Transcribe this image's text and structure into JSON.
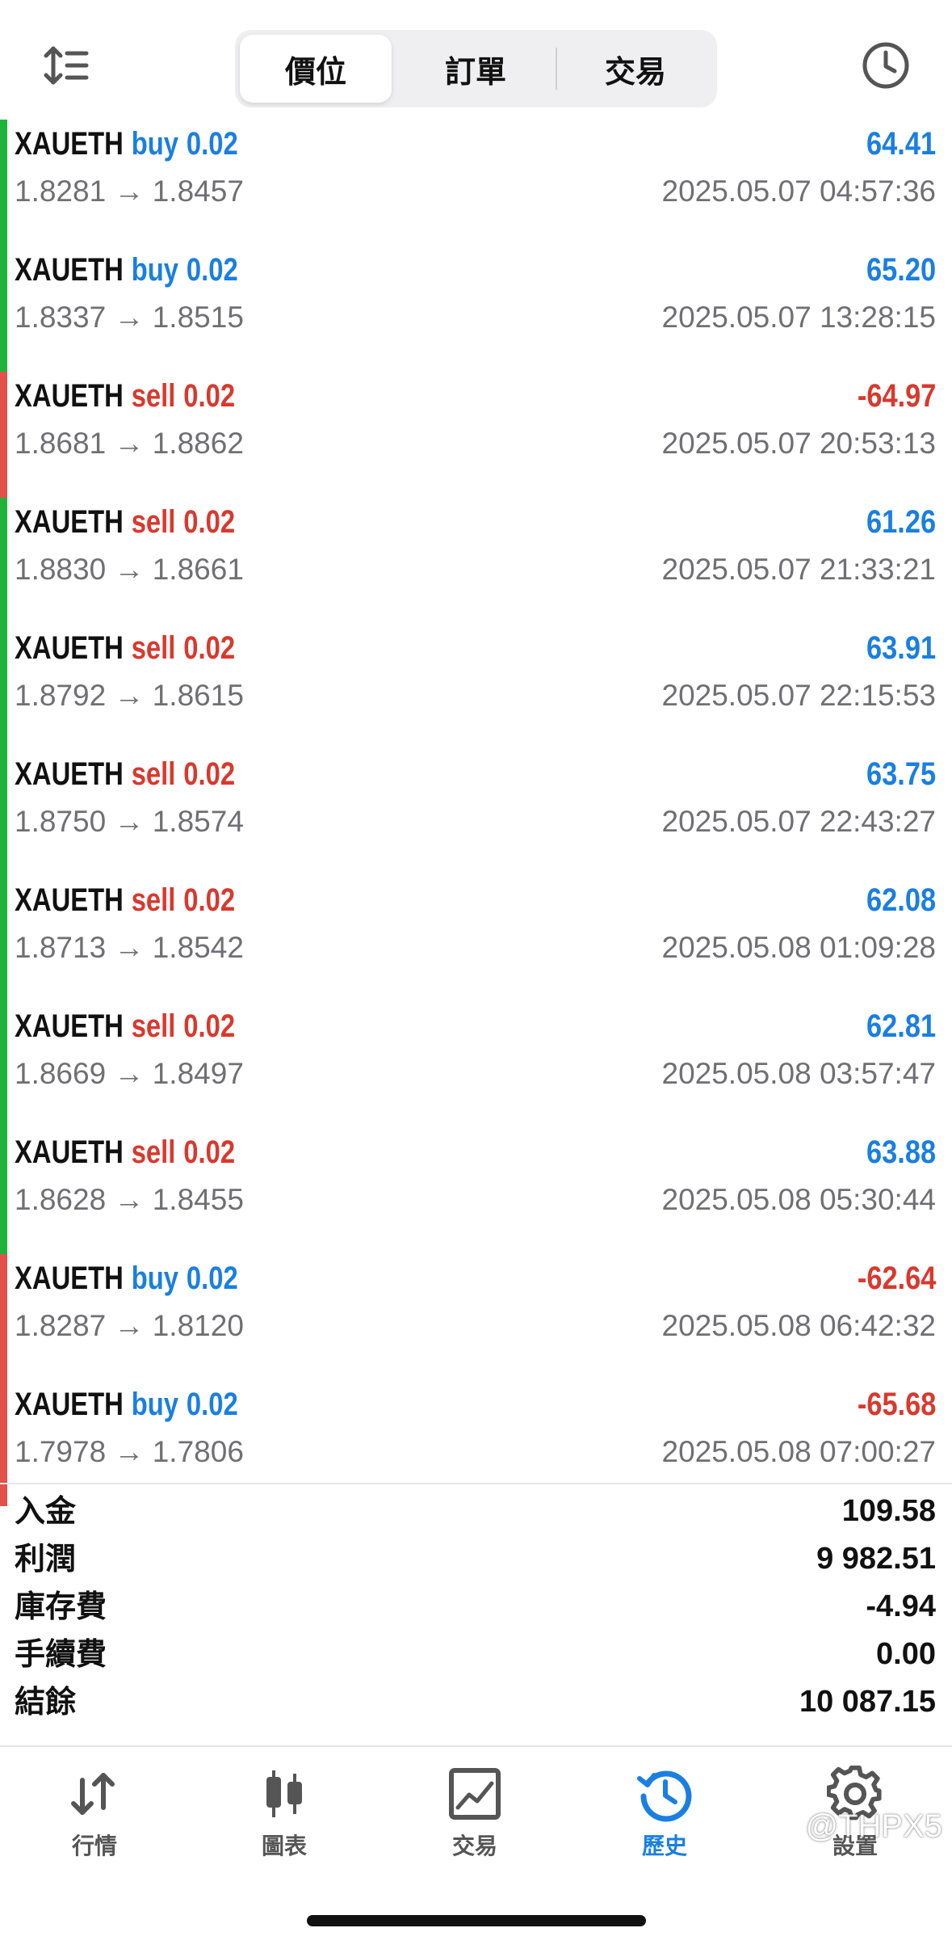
{
  "header": {
    "tabs": [
      {
        "label": "價位",
        "active": true
      },
      {
        "label": "訂單",
        "active": false
      },
      {
        "label": "交易",
        "active": false
      }
    ],
    "icons": {
      "sort": "sort-updown-icon",
      "history_period": "clock-icon"
    }
  },
  "deals": [
    {
      "symbol": "XAUETH",
      "type": "buy",
      "volume": "0.02",
      "profit": "64.41",
      "open": "1.8281",
      "close": "1.8457",
      "time": "2025.05.07 04:57:36",
      "bar_color": "#1fb33a",
      "type_color": "#1a7fe0",
      "profit_color": "#1a7fe0"
    },
    {
      "symbol": "XAUETH",
      "type": "buy",
      "volume": "0.02",
      "profit": "65.20",
      "open": "1.8337",
      "close": "1.8515",
      "time": "2025.05.07 13:28:15",
      "bar_color": "#1fb33a",
      "type_color": "#1a7fe0",
      "profit_color": "#1a7fe0"
    },
    {
      "symbol": "XAUETH",
      "type": "sell",
      "volume": "0.02",
      "profit": "-64.97",
      "open": "1.8681",
      "close": "1.8862",
      "time": "2025.05.07 20:53:13",
      "bar_color": "#e2514a",
      "type_color": "#d8392e",
      "profit_color": "#d8392e"
    },
    {
      "symbol": "XAUETH",
      "type": "sell",
      "volume": "0.02",
      "profit": "61.26",
      "open": "1.8830",
      "close": "1.8661",
      "time": "2025.05.07 21:33:21",
      "bar_color": "#1fb33a",
      "type_color": "#d8392e",
      "profit_color": "#1a7fe0"
    },
    {
      "symbol": "XAUETH",
      "type": "sell",
      "volume": "0.02",
      "profit": "63.91",
      "open": "1.8792",
      "close": "1.8615",
      "time": "2025.05.07 22:15:53",
      "bar_color": "#1fb33a",
      "type_color": "#d8392e",
      "profit_color": "#1a7fe0"
    },
    {
      "symbol": "XAUETH",
      "type": "sell",
      "volume": "0.02",
      "profit": "63.75",
      "open": "1.8750",
      "close": "1.8574",
      "time": "2025.05.07 22:43:27",
      "bar_color": "#1fb33a",
      "type_color": "#d8392e",
      "profit_color": "#1a7fe0"
    },
    {
      "symbol": "XAUETH",
      "type": "sell",
      "volume": "0.02",
      "profit": "62.08",
      "open": "1.8713",
      "close": "1.8542",
      "time": "2025.05.08 01:09:28",
      "bar_color": "#1fb33a",
      "type_color": "#d8392e",
      "profit_color": "#1a7fe0"
    },
    {
      "symbol": "XAUETH",
      "type": "sell",
      "volume": "0.02",
      "profit": "62.81",
      "open": "1.8669",
      "close": "1.8497",
      "time": "2025.05.08 03:57:47",
      "bar_color": "#1fb33a",
      "type_color": "#d8392e",
      "profit_color": "#1a7fe0"
    },
    {
      "symbol": "XAUETH",
      "type": "sell",
      "volume": "0.02",
      "profit": "63.88",
      "open": "1.8628",
      "close": "1.8455",
      "time": "2025.05.08 05:30:44",
      "bar_color": "#1fb33a",
      "type_color": "#d8392e",
      "profit_color": "#1a7fe0"
    },
    {
      "symbol": "XAUETH",
      "type": "buy",
      "volume": "0.02",
      "profit": "-62.64",
      "open": "1.8287",
      "close": "1.8120",
      "time": "2025.05.08 06:42:32",
      "bar_color": "#e2514a",
      "type_color": "#1a7fe0",
      "profit_color": "#d8392e"
    },
    {
      "symbol": "XAUETH",
      "type": "buy",
      "volume": "0.02",
      "profit": "-65.68",
      "open": "1.7978",
      "close": "1.7806",
      "time": "2025.05.08 07:00:27",
      "bar_color": "#e2514a",
      "type_color": "#1a7fe0",
      "profit_color": "#d8392e"
    }
  ],
  "arrow": "→",
  "summary": [
    {
      "label": "入金",
      "value": "109.58"
    },
    {
      "label": "利潤",
      "value": "9 982.51"
    },
    {
      "label": "庫存費",
      "value": "-4.94"
    },
    {
      "label": "手續費",
      "value": "0.00"
    },
    {
      "label": "結餘",
      "value": "10 087.15"
    }
  ],
  "tabbar": [
    {
      "label": "行情",
      "icon": "quotes-arrows-icon",
      "active": false
    },
    {
      "label": "圖表",
      "icon": "candlestick-chart-icon",
      "active": false
    },
    {
      "label": "交易",
      "icon": "trade-chart-icon",
      "active": false
    },
    {
      "label": "歷史",
      "icon": "history-clock-icon",
      "active": true
    },
    {
      "label": "設置",
      "icon": "gear-icon",
      "active": false
    }
  ],
  "colors": {
    "accent": "#1a7fe0",
    "loss": "#d8392e",
    "win_bar": "#1fb33a",
    "loss_bar": "#e2514a"
  },
  "watermark": "@THPX5"
}
